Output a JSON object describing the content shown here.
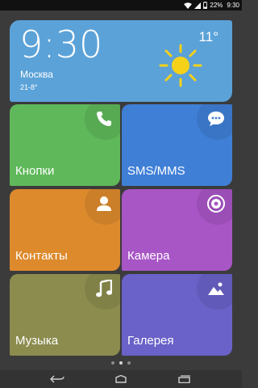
{
  "status_bar": {
    "battery_percent": "22%",
    "time": "9:30",
    "icons": [
      "wifi-icon",
      "signal-icon",
      "battery-icon"
    ]
  },
  "weather": {
    "time": "9:30",
    "city": "Москва",
    "temp_range": "21-8°",
    "temp_now": "11°",
    "icon": "sun-icon"
  },
  "tiles": [
    {
      "label": "Кнопки",
      "icon": "phone-icon",
      "color": "#5fb85a"
    },
    {
      "label": "SMS/MMS",
      "icon": "chat-bubble-icon",
      "color": "#3f7fd6"
    },
    {
      "label": "Контакты",
      "icon": "person-icon",
      "color": "#dd8a2d"
    },
    {
      "label": "Камера",
      "icon": "camera-lens-icon",
      "color": "#a855c6"
    },
    {
      "label": "Музыка",
      "icon": "music-note-icon",
      "color": "#8b8c4e"
    },
    {
      "label": "Галерея",
      "icon": "picture-icon",
      "color": "#6a62c8"
    }
  ],
  "page_indicator": {
    "pages": 3,
    "current": 1
  },
  "nav_bar": {
    "buttons": [
      "back-icon",
      "home-icon",
      "recent-apps-icon"
    ]
  }
}
